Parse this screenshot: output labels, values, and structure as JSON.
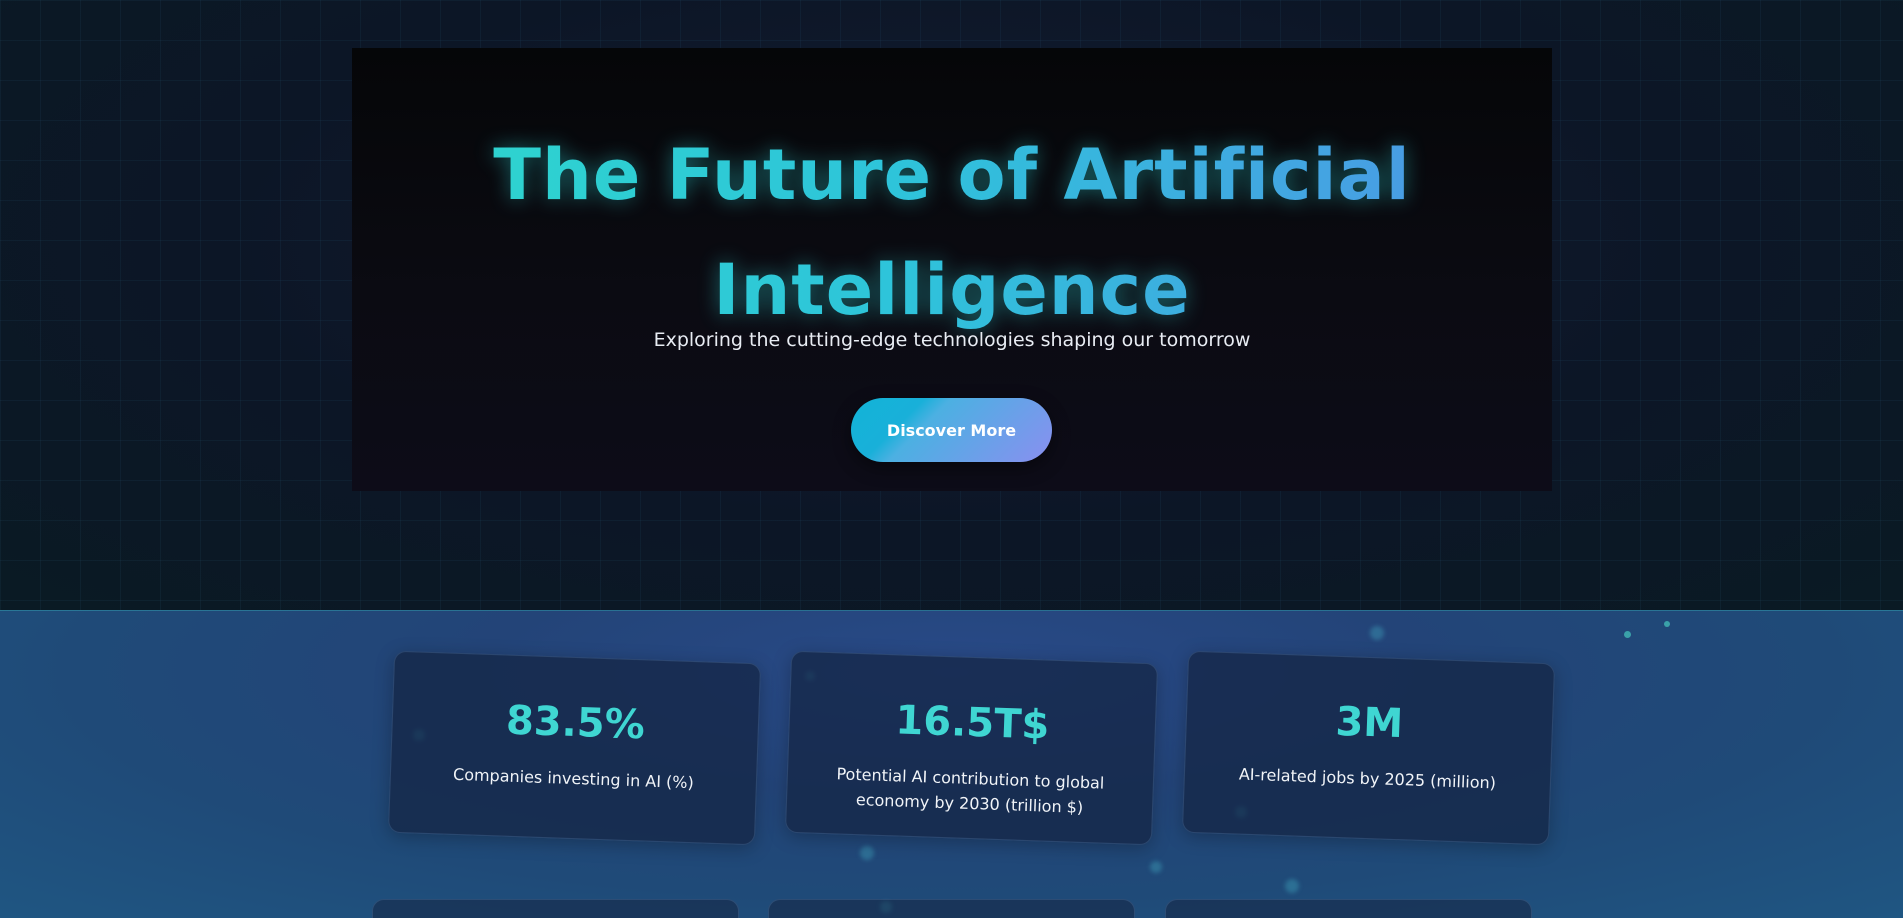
{
  "hero": {
    "title_line1": "The Future of Artificial",
    "title_line2": "Intelligence",
    "subtitle": "Exploring the cutting-edge technologies shaping our tomorrow",
    "cta_label": "Discover More"
  },
  "stats": [
    {
      "value": "83.5%",
      "label": "Companies investing in AI (%)"
    },
    {
      "value": "16.5T$",
      "label": "Potential AI contribution to global economy by 2030 (trillion $)"
    },
    {
      "value": "3M",
      "label": "AI-related jobs by 2025 (million)"
    }
  ],
  "colors": {
    "accent": "#3fd6d2",
    "title_gradient_start": "#2ed8cc",
    "title_gradient_end": "#4f93e6",
    "button_gradient_start": "#12b4d8",
    "button_gradient_end": "#8a8ff0",
    "stats_background": "#234478"
  }
}
